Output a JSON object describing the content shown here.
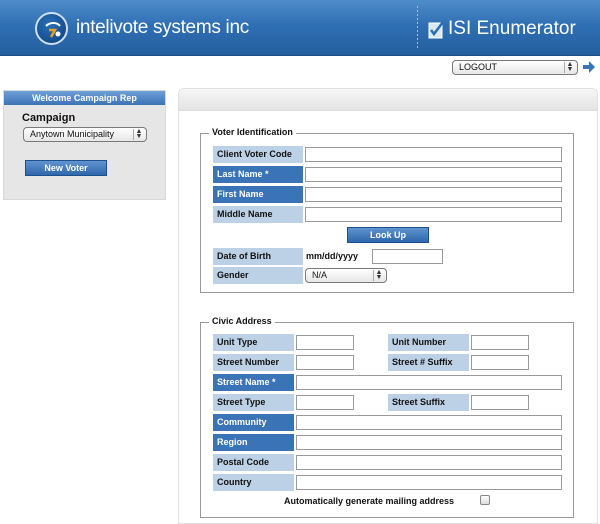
{
  "header": {
    "brand": "intelivote systems inc",
    "product": "ISI Enumerator",
    "logout_select": "LOGOUT"
  },
  "sidebar": {
    "welcome": "Welcome Campaign Rep",
    "campaign_label": "Campaign",
    "campaign_select": "Anytown Municipality",
    "new_voter_button": "New Voter"
  },
  "voter_identification": {
    "legend": "Voter Identification",
    "client_voter_code": {
      "label": "Client Voter Code",
      "value": ""
    },
    "last_name": {
      "label": "Last Name *",
      "value": ""
    },
    "first_name": {
      "label": "First Name",
      "value": ""
    },
    "middle_name": {
      "label": "Middle Name",
      "value": ""
    },
    "look_up_button": "Look Up",
    "date_of_birth": {
      "label": "Date of Birth",
      "format": "mm/dd/yyyy",
      "value": ""
    },
    "gender": {
      "label": "Gender",
      "value": "N/A"
    }
  },
  "civic_address": {
    "legend": "Civic Address",
    "unit_type": {
      "label": "Unit Type",
      "value": ""
    },
    "unit_number": {
      "label": "Unit Number",
      "value": ""
    },
    "street_number": {
      "label": "Street Number",
      "value": ""
    },
    "street_number_suffix": {
      "label": "Street # Suffix",
      "value": ""
    },
    "street_name": {
      "label": "Street Name *",
      "value": ""
    },
    "street_type": {
      "label": "Street Type",
      "value": ""
    },
    "street_suffix": {
      "label": "Street Suffix",
      "value": ""
    },
    "community": {
      "label": "Community",
      "value": ""
    },
    "region": {
      "label": "Region",
      "value": ""
    },
    "postal_code": {
      "label": "Postal Code",
      "value": ""
    },
    "country": {
      "label": "Country",
      "value": ""
    },
    "auto_mailing_label": "Automatically generate mailing address"
  },
  "colors": {
    "header_blue": "#2f6fb3",
    "label_light": "#bcd0e6",
    "label_dark": "#3a74b6",
    "button_blue": "#3b73b6"
  }
}
